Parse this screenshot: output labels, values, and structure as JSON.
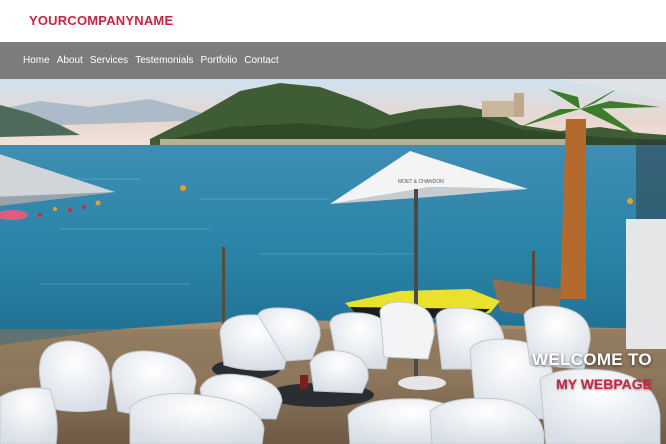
{
  "header": {
    "logo_text": "YOURCOMPANYNAME",
    "brand_color": "#c8243f"
  },
  "nav": {
    "items": [
      {
        "label": "Home",
        "name": "nav-home"
      },
      {
        "label": "About",
        "name": "nav-about"
      },
      {
        "label": "Services",
        "name": "nav-services"
      },
      {
        "label": "Testemonials",
        "name": "nav-testemonials"
      },
      {
        "label": "Portfolio",
        "name": "nav-portfolio"
      },
      {
        "label": "Contact",
        "name": "nav-contact"
      }
    ],
    "background": "#7c7c7c"
  },
  "hero": {
    "image_alt": "Lakeside cafe terrace with white chairs and umbrellas",
    "caption_line1": "WELCOME TO",
    "caption_line2": "MY WEBPAGE",
    "caption_accent": "#c8243f",
    "umbrella_text": "MOET & CHANDON"
  }
}
